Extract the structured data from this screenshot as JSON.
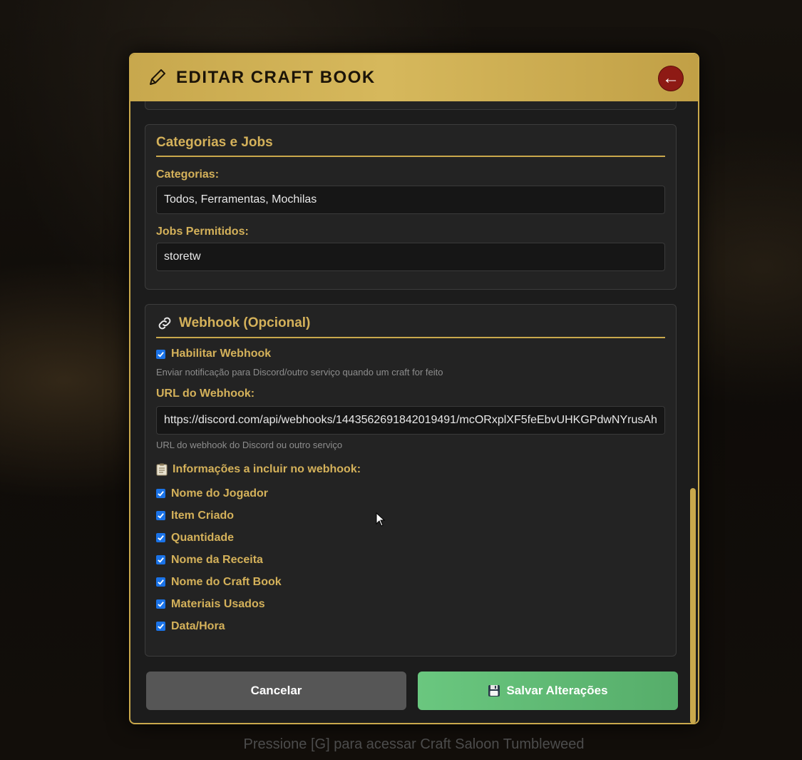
{
  "modal": {
    "title": "EDITAR CRAFT BOOK",
    "back_icon": "←"
  },
  "categories_section": {
    "title": "Categorias e Jobs",
    "categories_label": "Categorias:",
    "categories_value": "Todos, Ferramentas, Mochilas",
    "jobs_label": "Jobs Permitidos:",
    "jobs_value": "storetw"
  },
  "webhook_section": {
    "title": "Webhook (Opcional)",
    "enable_label": "Habilitar Webhook",
    "enable_checked": true,
    "enable_hint": "Enviar notificação para Discord/outro serviço quando um craft for feito",
    "url_label": "URL do Webhook:",
    "url_value": "https://discord.com/api/webhooks/1443562691842019491/mcORxplXF5feEbvUHKGPdwNYrusAh",
    "url_hint": "URL do webhook do Discord ou outro serviço",
    "info_title": "Informações a incluir no webhook:",
    "info_options": [
      {
        "label": "Nome do Jogador",
        "checked": true
      },
      {
        "label": "Item Criado",
        "checked": true
      },
      {
        "label": "Quantidade",
        "checked": true
      },
      {
        "label": "Nome da Receita",
        "checked": true
      },
      {
        "label": "Nome do Craft Book",
        "checked": true
      },
      {
        "label": "Materiais Usados",
        "checked": true
      },
      {
        "label": "Data/Hora",
        "checked": true
      }
    ]
  },
  "actions": {
    "cancel_label": "Cancelar",
    "save_label": "Salvar Alterações"
  },
  "footer_hint": "Pressione [G] para acessar Craft Saloon Tumbleweed",
  "colors": {
    "gold": "#c9a84c",
    "label_gold": "#d4b15a",
    "back_button": "#8e1a14",
    "save_button": "#62bb76",
    "cancel_button": "#565656",
    "checkbox": "#1a73e8"
  }
}
